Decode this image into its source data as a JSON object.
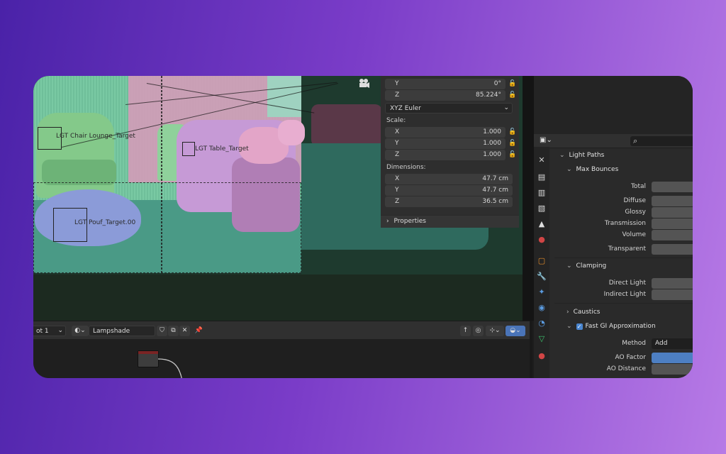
{
  "transform_panel": {
    "rotation": [
      {
        "axis": "Y",
        "value": "0°"
      },
      {
        "axis": "Z",
        "value": "85.224°"
      }
    ],
    "rotation_mode": "XYZ Euler",
    "scale_label": "Scale:",
    "scale": [
      {
        "axis": "X",
        "value": "1.000"
      },
      {
        "axis": "Y",
        "value": "1.000"
      },
      {
        "axis": "Z",
        "value": "1.000"
      }
    ],
    "dimensions_label": "Dimensions:",
    "dimensions": [
      {
        "axis": "X",
        "value": "47.7 cm"
      },
      {
        "axis": "Y",
        "value": "47.7 cm"
      },
      {
        "axis": "Z",
        "value": "36.5 cm"
      }
    ],
    "properties_label": "Properties"
  },
  "viewport": {
    "labels": [
      "LGT Chair Lounge_Target",
      "LGT Table_Target",
      "LGT Pouf_Target.00"
    ]
  },
  "node_header": {
    "slot_label": "ot 1",
    "material_name": "Lampshade"
  },
  "properties": {
    "light_paths": "Light Paths",
    "max_bounces": "Max Bounces",
    "total": "Total",
    "diffuse": "Diffuse",
    "glossy": "Glossy",
    "transmission": "Transmission",
    "volume": "Volume",
    "transparent": "Transparent",
    "clamping": "Clamping",
    "direct_light": "Direct Light",
    "indirect_light": "Indirect Light",
    "caustics": "Caustics",
    "fast_gi": "Fast GI Approximation",
    "method_label": "Method",
    "method_value": "Add",
    "ao_factor": "AO Factor",
    "ao_distance": "AO Distance"
  },
  "colors": {
    "accent": "#4d7fc2",
    "background_start": "#4a22a8",
    "background_end": "#b77ae6"
  },
  "icons": [
    "camera-icon",
    "lock-icon",
    "search-icon",
    "chevron-down-icon",
    "chevron-right-icon",
    "checkbox-icon",
    "pin-icon",
    "shield-icon",
    "copy-icon",
    "close-icon"
  ]
}
